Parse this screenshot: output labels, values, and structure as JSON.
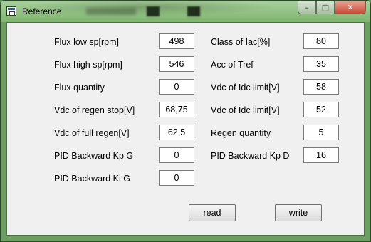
{
  "window": {
    "title": "Reference",
    "minimize_glyph": "–",
    "maximize_glyph": "□",
    "close_glyph": "✕"
  },
  "left_column": [
    {
      "label": "Flux low sp[rpm]",
      "value": "498"
    },
    {
      "label": "Flux high sp[rpm]",
      "value": "546"
    },
    {
      "label": "Flux quantity",
      "value": "0"
    },
    {
      "label": "Vdc of regen stop[V]",
      "value": "68,75"
    },
    {
      "label": "Vdc of full regen[V]",
      "value": "62,5"
    },
    {
      "label": "PID Backward Kp G",
      "value": "0"
    },
    {
      "label": "PID Backward Ki G",
      "value": "0"
    }
  ],
  "right_column": [
    {
      "label": "Class of Iac[%]",
      "value": "80"
    },
    {
      "label": "Acc of Tref",
      "value": "35"
    },
    {
      "label": "Vdc of Idc limit[V]",
      "value": "58"
    },
    {
      "label": "Vdc of Idc limit[V]",
      "value": "52"
    },
    {
      "label": "Regen quantity",
      "value": "5"
    },
    {
      "label": "PID Backward Kp D",
      "value": "16"
    }
  ],
  "buttons": {
    "read": "read",
    "write": "write"
  }
}
